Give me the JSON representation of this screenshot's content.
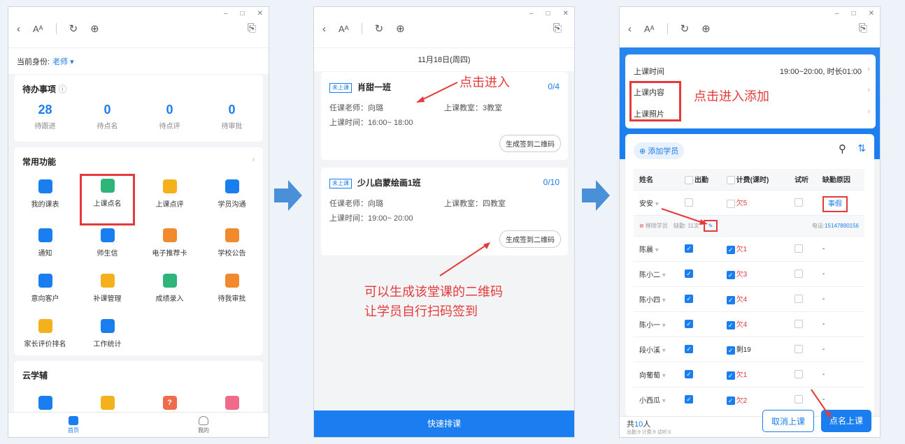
{
  "p1": {
    "role_label": "当前身份:",
    "role_value": "老师",
    "todo_title": "待办事项",
    "stats": [
      {
        "n": "28",
        "l": "待跟进"
      },
      {
        "n": "0",
        "l": "待点名"
      },
      {
        "n": "0",
        "l": "待点评"
      },
      {
        "n": "0",
        "l": "待审批"
      }
    ],
    "common_title": "常用功能",
    "items": [
      {
        "l": "我的课表",
        "c": "#1a7ef0"
      },
      {
        "l": "上课点名",
        "c": "#2fb57a"
      },
      {
        "l": "上课点评",
        "c": "#f5b11c"
      },
      {
        "l": "学员沟通",
        "c": "#1a7ef0"
      },
      {
        "l": "通知",
        "c": "#1a7ef0"
      },
      {
        "l": "师生信",
        "c": "#1a7ef0"
      },
      {
        "l": "电子推荐卡",
        "c": "#f08a2c"
      },
      {
        "l": "学校公告",
        "c": "#f08a2c"
      },
      {
        "l": "意向客户",
        "c": "#1a7ef0"
      },
      {
        "l": "补课管理",
        "c": "#f5b11c"
      },
      {
        "l": "成绩录入",
        "c": "#2fb57a"
      },
      {
        "l": "待我审批",
        "c": "#f08a2c"
      },
      {
        "l": "家长评价排名",
        "c": "#f5b11c"
      },
      {
        "l": "工作统计",
        "c": "#1a7ef0"
      }
    ],
    "cloud_title": "云学辅",
    "nav": {
      "home": "首页",
      "mine": "我的"
    }
  },
  "p2": {
    "date": "11月18日(周四)",
    "classes": [
      {
        "tag": "未上课",
        "name": "肖甜一班",
        "count": "0/4",
        "teacher": "任课老师：向璐",
        "room": "上课教室：3教室",
        "time": "上课时间：16:00~ 18:00",
        "qr": "生成签到二维码"
      },
      {
        "tag": "未上课",
        "name": "少儿启蒙绘画1班",
        "count": "0/10",
        "teacher": "任课老师：向璐",
        "room": "上课教室：四教室",
        "time": "上课时间：19:00~ 20:00",
        "qr": "生成签到二维码"
      }
    ],
    "ann1": "点击进入",
    "ann2a": "可以生成该堂课的二维码",
    "ann2b": "让学员自行扫码签到",
    "bottom": "快速排课"
  },
  "p3": {
    "time_label": "上课时间",
    "time_value": "19:00~20:00, 时长01:00",
    "content_label": "上课内容",
    "photo_label": "上课照片",
    "ann": "点击进入添加",
    "add_student": "添加学员",
    "headers": [
      "姓名",
      "出勤",
      "计费(课时)",
      "试听",
      "缺勤原因"
    ],
    "rows": [
      {
        "name": "安安",
        "att": false,
        "fee": "欠5",
        "reason": "事假"
      },
      {
        "name": "陈晨",
        "att": true,
        "fee": "欠1",
        "reason": "-"
      },
      {
        "name": "陈小二",
        "att": true,
        "fee": "欠3",
        "reason": "-"
      },
      {
        "name": "陈小四",
        "att": true,
        "fee": "欠4",
        "reason": "-"
      },
      {
        "name": "陈小一",
        "att": true,
        "fee": "欠4",
        "reason": "-"
      },
      {
        "name": "段小溪",
        "att": true,
        "fee": "剩19",
        "reason": "-"
      },
      {
        "name": "向葡萄",
        "att": true,
        "fee": "欠1",
        "reason": "-"
      },
      {
        "name": "小西瓜",
        "att": true,
        "fee": "欠2",
        "reason": "-"
      }
    ],
    "sub": {
      "remove": "移除学员",
      "absent": "缺勤: 11次",
      "phone_label": "电话:",
      "phone": "15147890156"
    },
    "total_prefix": "共",
    "total": "10",
    "total_suffix": "人",
    "summary": "出勤:9  计费:9  试听:0",
    "cancel": "取消上课",
    "confirm": "点名上课"
  }
}
